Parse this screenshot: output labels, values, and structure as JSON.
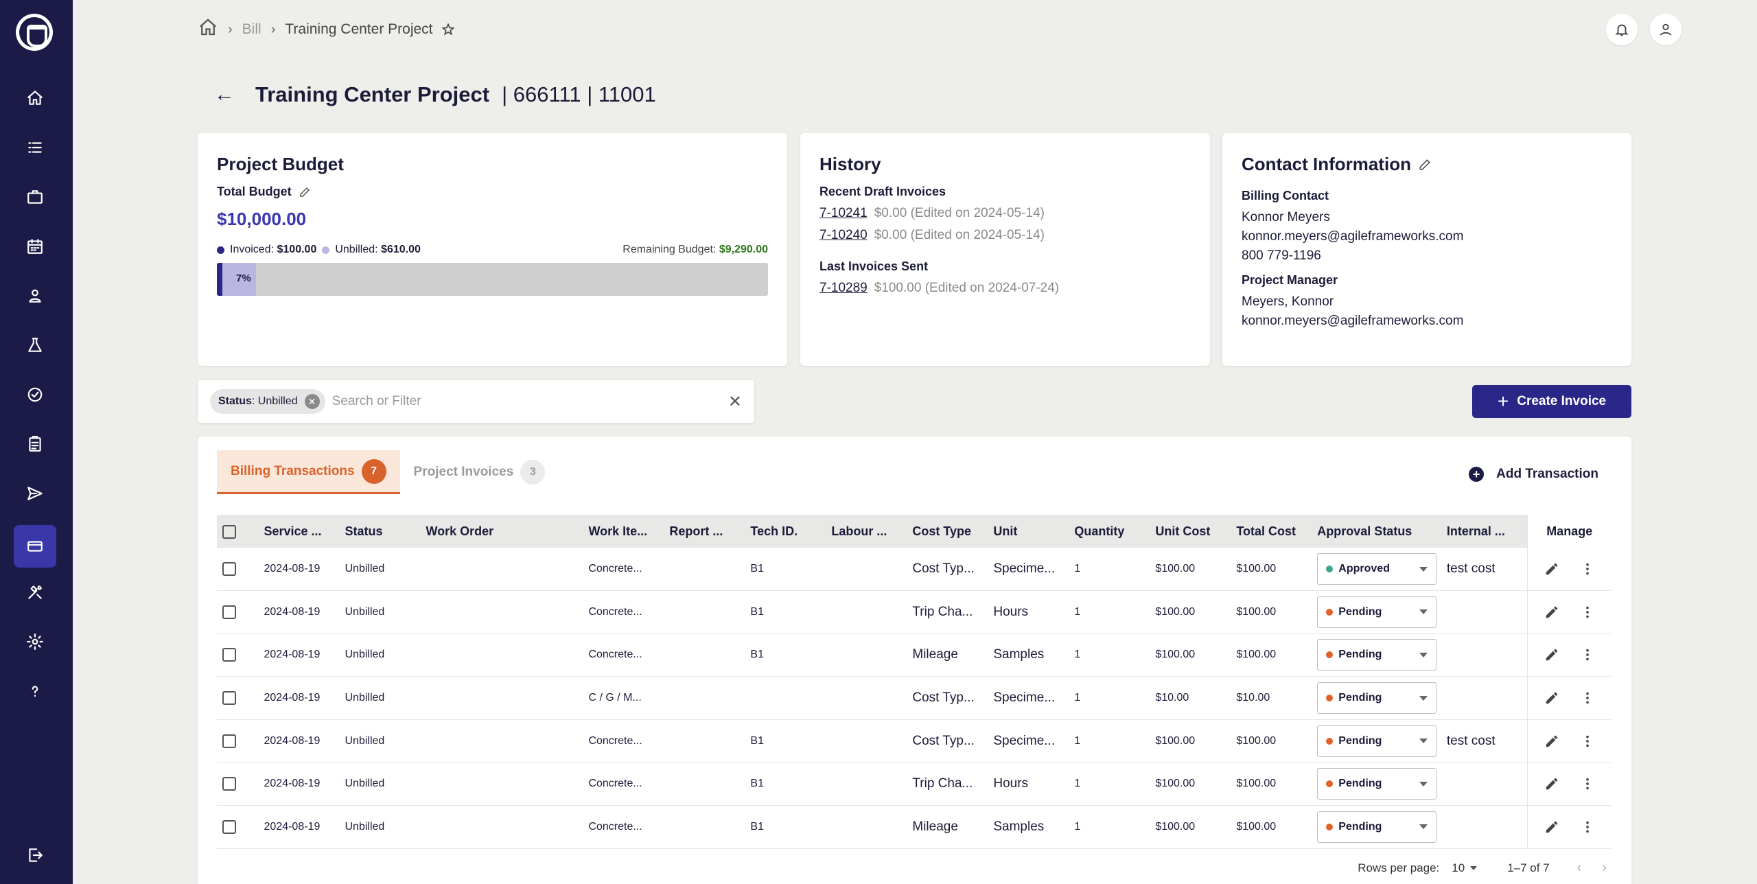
{
  "sidebar": {
    "items": [
      {
        "name": "home",
        "active": false
      },
      {
        "name": "list",
        "active": false
      },
      {
        "name": "briefcase",
        "active": false
      },
      {
        "name": "calendar",
        "active": false
      },
      {
        "name": "person",
        "active": false
      },
      {
        "name": "flask",
        "active": false
      },
      {
        "name": "check-badge",
        "active": false
      },
      {
        "name": "clipboard",
        "active": false
      },
      {
        "name": "send",
        "active": false
      },
      {
        "name": "credit-card",
        "active": true
      },
      {
        "name": "tools",
        "active": false
      },
      {
        "name": "gear",
        "active": false
      },
      {
        "name": "help",
        "active": false
      },
      {
        "name": "logout",
        "active": false
      }
    ]
  },
  "breadcrumb": {
    "level1": "Bill",
    "current": "Training Center Project"
  },
  "header": {
    "title": "Training Center Project",
    "subtitle": "| 666111 | 11001"
  },
  "budget": {
    "title": "Project Budget",
    "total_label": "Total Budget",
    "total_value": "$10,000.00",
    "invoiced_label": "Invoiced:",
    "invoiced_value": "$100.00",
    "unbilled_label": "Unbilled:",
    "unbilled_value": "$610.00",
    "remaining_label": "Remaining Budget:",
    "remaining_value": "$9,290.00",
    "percent_label": "7%",
    "invoiced_fraction": 0.01,
    "unbilled_fraction": 0.061,
    "colors": {
      "invoiced": "#2a2789",
      "unbilled": "#b9b7e2",
      "remaining": "#2d7a1e"
    }
  },
  "history": {
    "title": "History",
    "recent_label": "Recent Draft Invoices",
    "recent": [
      {
        "id": "7-10241",
        "amount": "$0.00",
        "note": "(Edited on 2024-05-14)"
      },
      {
        "id": "7-10240",
        "amount": "$0.00",
        "note": "(Edited on 2024-05-14)"
      }
    ],
    "sent_label": "Last Invoices Sent",
    "sent": [
      {
        "id": "7-10289",
        "amount": "$100.00",
        "note": "(Edited on 2024-07-24)"
      }
    ]
  },
  "contact": {
    "title": "Contact Information",
    "billing_label": "Billing Contact",
    "billing_name": "Konnor Meyers",
    "billing_email": "konnor.meyers@agileframeworks.com",
    "billing_phone": "800 779-1196",
    "pm_label": "Project Manager",
    "pm_name": "Meyers, Konnor",
    "pm_email": "konnor.meyers@agileframeworks.com"
  },
  "filter": {
    "chip_key": "Status",
    "chip_value": ": Unbilled",
    "placeholder": "Search or Filter"
  },
  "create_invoice": {
    "label": "Create Invoice"
  },
  "tabs": [
    {
      "label": "Billing Transactions",
      "count": "7"
    },
    {
      "label": "Project Invoices",
      "count": "3"
    }
  ],
  "add_transaction": {
    "label": "Add Transaction"
  },
  "table": {
    "columns": [
      "Service ...",
      "Status",
      "Work Order",
      "Work Ite...",
      "Report ...",
      "Tech ID.",
      "Labour ...",
      "Cost Type",
      "Unit",
      "Quantity",
      "Unit Cost",
      "Total Cost",
      "Approval Status",
      "Internal ...",
      "Manage"
    ],
    "rows": [
      {
        "date": "2024-08-19",
        "status": "Unbilled",
        "work_order": "",
        "work_item": "Concrete...",
        "report": "",
        "tech": "B1",
        "labour": "",
        "cost_type": "Cost Typ...",
        "unit": "Specime...",
        "qty": "1",
        "unit_cost": "$100.00",
        "total": "$100.00",
        "approval": "Approved",
        "internal": "test cost"
      },
      {
        "date": "2024-08-19",
        "status": "Unbilled",
        "work_order": "",
        "work_item": "Concrete...",
        "report": "",
        "tech": "B1",
        "labour": "",
        "cost_type": "Trip Cha...",
        "unit": "Hours",
        "qty": "1",
        "unit_cost": "$100.00",
        "total": "$100.00",
        "approval": "Pending",
        "internal": ""
      },
      {
        "date": "2024-08-19",
        "status": "Unbilled",
        "work_order": "",
        "work_item": "Concrete...",
        "report": "",
        "tech": "B1",
        "labour": "",
        "cost_type": "Mileage",
        "unit": "Samples",
        "qty": "1",
        "unit_cost": "$100.00",
        "total": "$100.00",
        "approval": "Pending",
        "internal": ""
      },
      {
        "date": "2024-08-19",
        "status": "Unbilled",
        "work_order": "",
        "work_item": "C / G / M...",
        "report": "",
        "tech": "",
        "labour": "",
        "cost_type": "Cost Typ...",
        "unit": "Specime...",
        "qty": "1",
        "unit_cost": "$10.00",
        "total": "$10.00",
        "approval": "Pending",
        "internal": ""
      },
      {
        "date": "2024-08-19",
        "status": "Unbilled",
        "work_order": "",
        "work_item": "Concrete...",
        "report": "",
        "tech": "B1",
        "labour": "",
        "cost_type": "Cost Typ...",
        "unit": "Specime...",
        "qty": "1",
        "unit_cost": "$100.00",
        "total": "$100.00",
        "approval": "Pending",
        "internal": "test cost"
      },
      {
        "date": "2024-08-19",
        "status": "Unbilled",
        "work_order": "",
        "work_item": "Concrete...",
        "report": "",
        "tech": "B1",
        "labour": "",
        "cost_type": "Trip Cha...",
        "unit": "Hours",
        "qty": "1",
        "unit_cost": "$100.00",
        "total": "$100.00",
        "approval": "Pending",
        "internal": ""
      },
      {
        "date": "2024-08-19",
        "status": "Unbilled",
        "work_order": "",
        "work_item": "Concrete...",
        "report": "",
        "tech": "B1",
        "labour": "",
        "cost_type": "Mileage",
        "unit": "Samples",
        "qty": "1",
        "unit_cost": "$100.00",
        "total": "$100.00",
        "approval": "Pending",
        "internal": ""
      }
    ],
    "approval_colors": {
      "Approved": "#3aa88a",
      "Pending": "#e0622b"
    }
  },
  "pagination": {
    "rows_per_page_label": "Rows per page:",
    "rows_per_page": "10",
    "range": "1–7 of 7"
  }
}
